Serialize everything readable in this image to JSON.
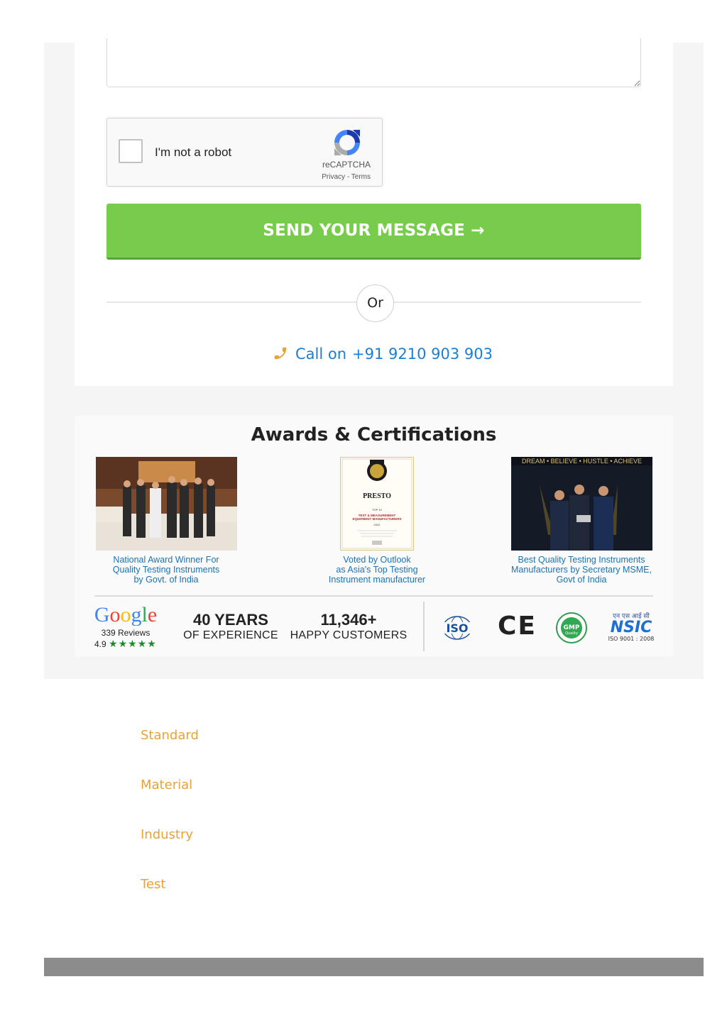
{
  "form": {
    "captcha": {
      "label": "I'm not a robot",
      "brand": "reCAPTCHA",
      "privacy": "Privacy",
      "separator": " - ",
      "terms": "Terms"
    },
    "send_label": "SEND YOUR MESSAGE →",
    "or_label": "Or",
    "call": {
      "prefix": "Call on",
      "number": "+91 9210 903 903",
      "icon": "phone-icon"
    }
  },
  "awards": {
    "title": "Awards & Certifications",
    "items": [
      {
        "line1": "National Award Winner For",
        "line2": "Quality Testing Instruments",
        "line3": "by Govt. of India"
      },
      {
        "line1": "Voted by Outlook",
        "line2": "as Asia's Top Testing",
        "line3": "Instrument manufacturer",
        "cert": {
          "brand": "PRESTO",
          "heading": "TEST & MEASUREMENT",
          "heading2": "EQUIPMENT MANUFACTURERS",
          "year": "2022",
          "top": "TOP 10"
        }
      },
      {
        "line1": "Best Quality Testing Instruments",
        "line2": "Manufacturers by Secretary MSME,",
        "line3": "Govt of India",
        "banner": "DREAM • BELIEVE • HUSTLE • ACHIEVE"
      }
    ]
  },
  "stats": {
    "google": {
      "logo": "Google",
      "reviews": "339 Reviews",
      "rating": "4.9",
      "stars": "★★★★★"
    },
    "experience": {
      "value": "40 YEARS",
      "label": "OF EXPERIENCE"
    },
    "customers": {
      "value": "11,346+",
      "label": "HAPPY CUSTOMERS"
    },
    "badges": {
      "iso": "ISO",
      "ce": "CE",
      "gmp": "GMP",
      "gmp_sub": "Quality",
      "nsic_hindi": "एन एस आई सी",
      "nsic": "NSIC",
      "nsic_sub": "ISO 9001 : 2008"
    }
  },
  "links": [
    "Standard",
    "Material",
    "Industry",
    "Test"
  ],
  "colors": {
    "send": "#78cc4b",
    "link_blue": "#1a7fd6",
    "orange": "#e8a238"
  }
}
